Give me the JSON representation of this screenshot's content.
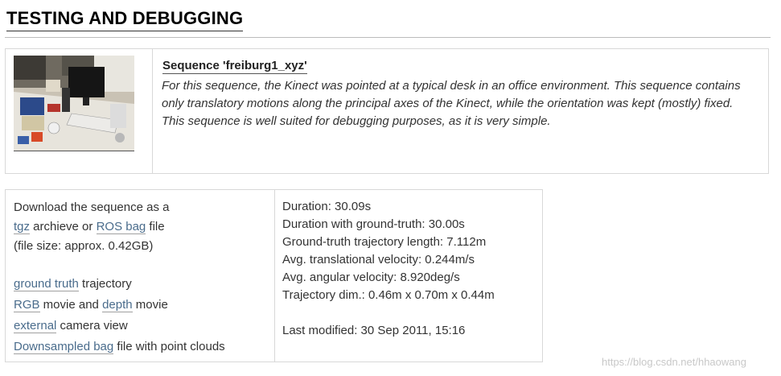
{
  "page": {
    "title": "TESTING AND DEBUGGING"
  },
  "sequence": {
    "title": "Sequence 'freiburg1_xyz'",
    "description": "For this sequence, the Kinect was pointed at a typical desk in an office environment. This sequence contains only translatory motions along the principal axes of the Kinect, while the orientation was kept (mostly) fixed. This sequence is well suited for debugging purposes, as it is very simple.",
    "thumbnail_icon": "office-desk-photo"
  },
  "download": {
    "intro": "Download the sequence as a",
    "tgz_link": "tgz",
    "archive_text": " archieve or ",
    "ros_bag_link": "ROS bag",
    "file_text": " file",
    "file_size": "(file size: approx. 0.42GB)",
    "ground_truth_link": "ground truth",
    "trajectory_text": " trajectory",
    "rgb_link": "RGB",
    "movie_and_text": " movie and ",
    "depth_link": "depth",
    "movie_text": " movie",
    "external_link": "external",
    "camera_view_text": " camera view",
    "downsampled_link": "Downsampled bag",
    "point_clouds_text": " file with point clouds"
  },
  "stats": {
    "duration": "Duration: 30.09s",
    "duration_gt": "Duration with ground-truth: 30.00s",
    "trajectory_length": "Ground-truth trajectory length: 7.112m",
    "trans_velocity": "Avg. translational velocity: 0.244m/s",
    "ang_velocity": "Avg. angular velocity: 8.920deg/s",
    "trajectory_dim": "Trajectory dim.: 0.46m x 0.70m x 0.44m",
    "last_modified": "Last modified: 30 Sep 2011, 15:16"
  },
  "watermark": "https://blog.csdn.net/hhaowang"
}
